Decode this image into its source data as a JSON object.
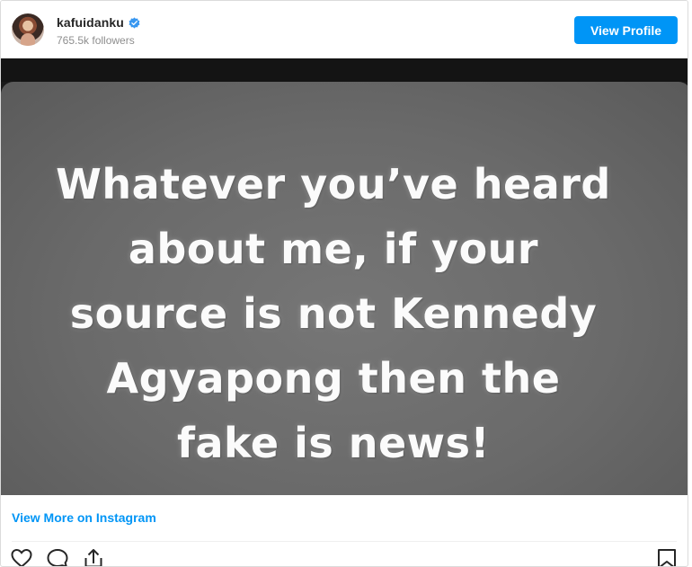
{
  "header": {
    "username": "kafuidanku",
    "verified": true,
    "followers": "765.5k followers",
    "view_profile_label": "View Profile"
  },
  "post": {
    "image_text_lines": [
      "Whatever you’ve heard",
      "about me, if your",
      "source is not Kennedy",
      "Agyapong then the",
      "fake is news!"
    ]
  },
  "footer": {
    "view_more_label": "View More on Instagram"
  },
  "icons": {
    "avatar": "profile-avatar",
    "verified": "verified-badge-icon",
    "like": "heart-icon",
    "comment": "comment-icon",
    "share": "share-icon",
    "save": "bookmark-icon"
  },
  "colors": {
    "accent": "#0095f6",
    "text": "#262626",
    "muted": "#8e8e8e"
  }
}
